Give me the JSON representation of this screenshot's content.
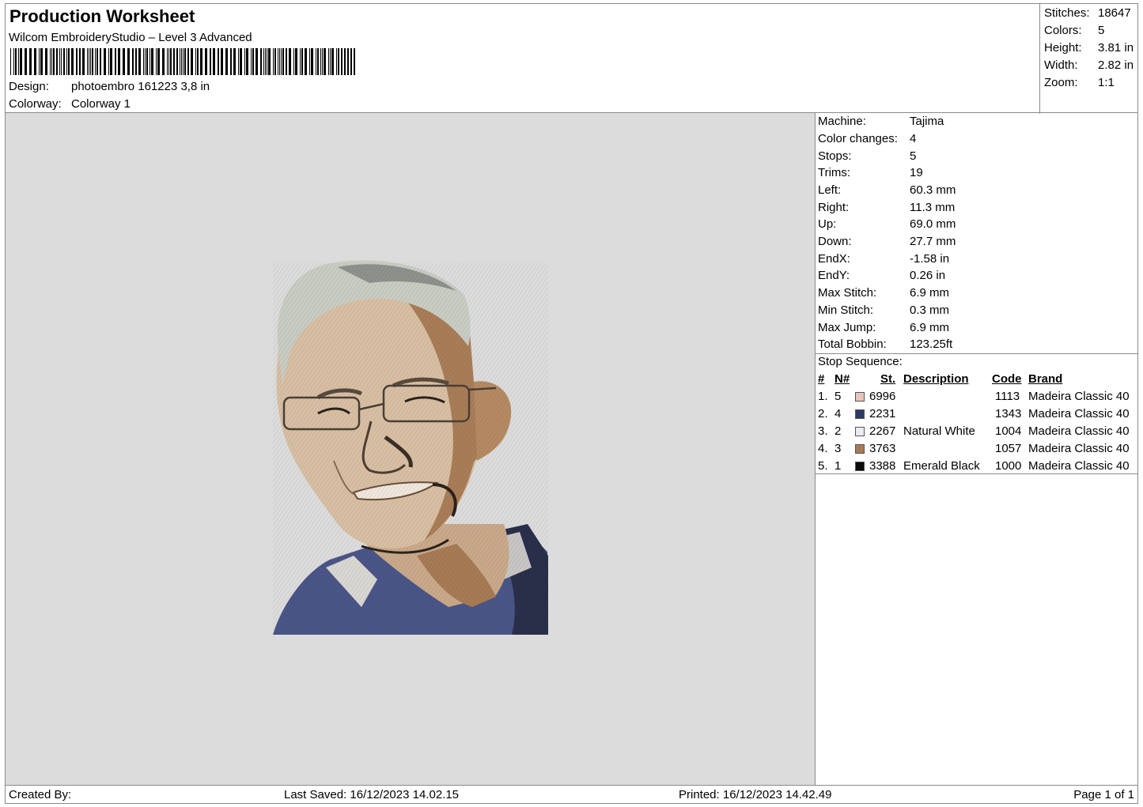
{
  "header": {
    "title": "Production Worksheet",
    "subtitle": "Wilcom EmbroideryStudio – Level 3 Advanced",
    "design_label": "Design:",
    "design_value": "photoembro 161223 3,8 in",
    "colorway_label": "Colorway:",
    "colorway_value": "Colorway 1"
  },
  "summary": {
    "stitches_label": "Stitches:",
    "stitches_value": "18647",
    "colors_label": "Colors:",
    "colors_value": "5",
    "height_label": "Height:",
    "height_value": "3.81 in",
    "width_label": "Width:",
    "width_value": "2.82 in",
    "zoom_label": "Zoom:",
    "zoom_value": "1:1"
  },
  "details": {
    "machine_label": "Machine:",
    "machine_value": "Tajima",
    "color_changes_label": "Color changes:",
    "color_changes_value": "4",
    "stops_label": "Stops:",
    "stops_value": "5",
    "trims_label": "Trims:",
    "trims_value": "19",
    "left_label": "Left:",
    "left_value": "60.3 mm",
    "right_label": "Right:",
    "right_value": "11.3 mm",
    "up_label": "Up:",
    "up_value": "69.0 mm",
    "down_label": "Down:",
    "down_value": "27.7 mm",
    "endx_label": "EndX:",
    "endx_value": "-1.58 in",
    "endy_label": "EndY:",
    "endy_value": "0.26 in",
    "max_stitch_label": "Max Stitch:",
    "max_stitch_value": "6.9 mm",
    "min_stitch_label": "Min Stitch:",
    "min_stitch_value": "0.3 mm",
    "max_jump_label": "Max Jump:",
    "max_jump_value": "6.9 mm",
    "total_bobbin_label": "Total Bobbin:",
    "total_bobbin_value": "123.25ft"
  },
  "stop_sequence": {
    "label": "Stop Sequence:",
    "headers": {
      "num": "#",
      "n": "N#",
      "st": "St.",
      "description": "Description",
      "code": "Code",
      "brand": "Brand"
    },
    "rows": [
      {
        "num": "1.",
        "n": "5",
        "color": "#e8c4bc",
        "st": "6996",
        "description": "",
        "code": "1113",
        "brand": "Madeira Classic 40"
      },
      {
        "num": "2.",
        "n": "4",
        "color": "#2e3a66",
        "st": "2231",
        "description": "",
        "code": "1343",
        "brand": "Madeira Classic 40"
      },
      {
        "num": "3.",
        "n": "2",
        "color": "#ecebef",
        "st": "2267",
        "description": "Natural White",
        "code": "1004",
        "brand": "Madeira Classic 40"
      },
      {
        "num": "4.",
        "n": "3",
        "color": "#a87a58",
        "st": "3763",
        "description": "",
        "code": "1057",
        "brand": "Madeira Classic 40"
      },
      {
        "num": "5.",
        "n": "1",
        "color": "#0a0a0a",
        "st": "3388",
        "description": "Emerald Black",
        "code": "1000",
        "brand": "Madeira Classic 40"
      }
    ]
  },
  "footer": {
    "created_by": "Created By:",
    "last_saved": "Last Saved: 16/12/2023 14.02.15",
    "printed": "Printed: 16/12/2023 14.42.49",
    "page": "Page 1 of 1"
  },
  "colors": {
    "preview_bg": "#dcdcdc",
    "border": "#8a8a8a"
  }
}
